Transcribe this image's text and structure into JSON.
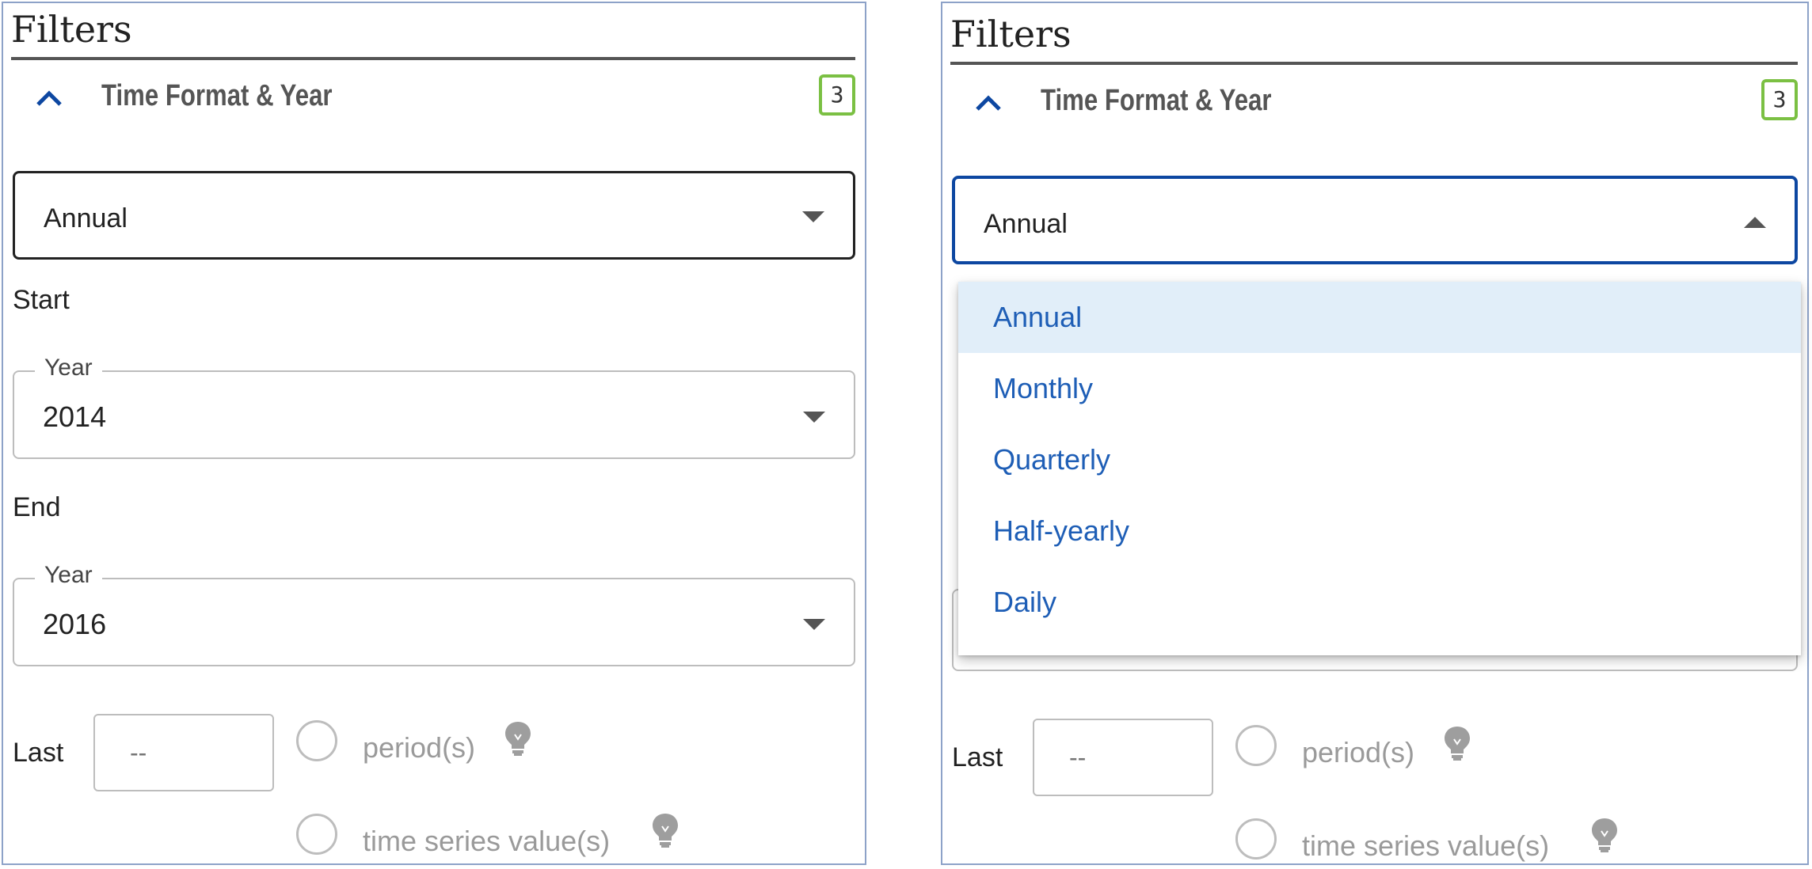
{
  "panels": [
    {
      "title": "Filters",
      "section": {
        "label": "Time Format & Year",
        "badge": "3"
      },
      "time_format": {
        "value": "Annual",
        "open": false
      },
      "start": {
        "label": "Start",
        "legend": "Year",
        "value": "2014"
      },
      "end": {
        "label": "End",
        "legend": "Year",
        "value": "2016"
      },
      "last": {
        "label": "Last",
        "placeholder": "--",
        "options": [
          "period(s)",
          "time series value(s)"
        ]
      }
    },
    {
      "title": "Filters",
      "section": {
        "label": "Time Format & Year",
        "badge": "3"
      },
      "time_format": {
        "value": "Annual",
        "open": true,
        "options": [
          "Annual",
          "Monthly",
          "Quarterly",
          "Half-yearly",
          "Daily"
        ],
        "selected_option": "Annual"
      },
      "last": {
        "label": "Last",
        "placeholder": "--",
        "options": [
          "period(s)",
          "time series value(s)"
        ]
      }
    }
  ],
  "colors": {
    "accent": "#0d47a1",
    "badge_border": "#7bc043",
    "menu_text": "#1e5eb6",
    "menu_selected_bg": "#e1eef9"
  },
  "icons": [
    "chevron-up-icon",
    "caret-down-icon",
    "caret-up-icon",
    "lightbulb-icon"
  ]
}
